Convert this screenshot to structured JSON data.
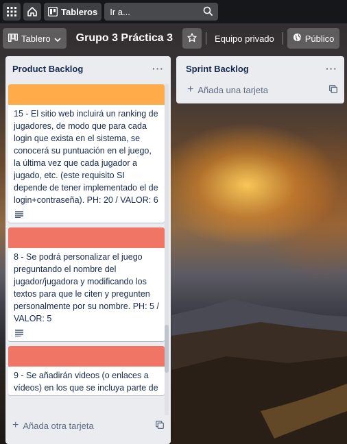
{
  "topbar": {
    "apps_icon": "grid-icon",
    "home_icon": "home-icon",
    "boards_label": "Tableros",
    "search_placeholder": "Ir a..."
  },
  "board": {
    "view_label": "Tablero",
    "title": "Grupo 3 Práctica 3",
    "team_label": "Equipo privado",
    "visibility_label": "Público"
  },
  "lists": [
    {
      "title": "Product Backlog",
      "add_label": "Añada otra tarjeta",
      "cards": [
        {
          "cover_color": "#ffab4a",
          "text": "15 - El sitio web incluirá un ranking de jugadores, de modo que para cada login que exista en el sistema, se conocerá su puntuación en el juego, la última vez que cada jugador a jugado, etc. (este requisito SI depende de tener implementado el de login+contraseña). PH: 20 / VALOR: 6",
          "has_description": true
        },
        {
          "cover_color": "#f07565",
          "text": "8 - Se podrá personalizar el juego preguntando el nombre del jugador/jugadora y modificando los textos para que le citen y pregunten personalmente por su nombre. PH: 5 / VALOR: 5",
          "has_description": true
        },
        {
          "cover_color": "#f07565",
          "text": "9 - Se añadirán videos (o enlaces a vídeos) en los que se incluya parte de",
          "has_description": false
        }
      ]
    },
    {
      "title": "Sprint Backlog",
      "add_label": "Añada una tarjeta",
      "cards": []
    }
  ]
}
